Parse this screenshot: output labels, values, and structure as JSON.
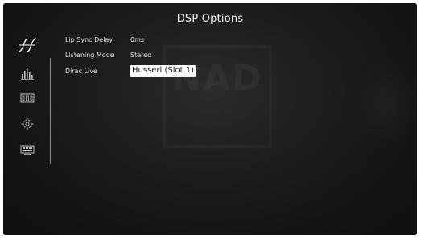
{
  "header": {
    "title": "DSP Options"
  },
  "sidebar": {
    "items": [
      {
        "icon": "waveform-icon",
        "active": true
      },
      {
        "icon": "equalizer-icon",
        "active": false
      },
      {
        "icon": "speaker-layout-icon",
        "active": false
      },
      {
        "icon": "settings-gear-icon",
        "active": false
      },
      {
        "icon": "display-icon",
        "active": false
      }
    ]
  },
  "settings": {
    "rows": [
      {
        "label": "Lip Sync Delay",
        "value": "0ms",
        "selected": false
      },
      {
        "label": "Listening Mode",
        "value": "Stereo",
        "selected": false
      },
      {
        "label": "Dirac Live",
        "value": "Husserl (Slot 1)",
        "selected": true
      }
    ]
  },
  "watermark": {
    "text": "NAD"
  },
  "colors": {
    "background": "#1a1a1a",
    "text": "#e4e4e4",
    "selected_background": "#ffffff",
    "selected_text": "#111111",
    "divider": "#8a8a8a"
  }
}
